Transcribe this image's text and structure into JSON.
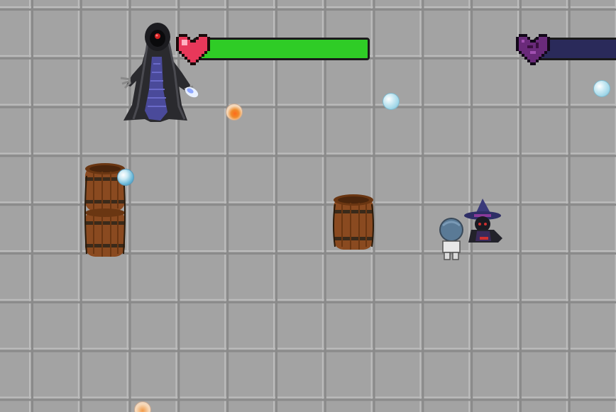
{
  "game": {
    "player_health": {
      "fraction": 1.0,
      "fill_color": "#2fcc26",
      "heart_color": "#e8385a",
      "icon": "heart-icon"
    },
    "enemy_health": {
      "fraction": 1.0,
      "fill_color": "#2a2a5a",
      "heart_color": "#6a2a7a",
      "icon": "dark-heart-icon"
    },
    "entities": {
      "boss": "hooded-reaper-boss",
      "player": "blue-haired-player",
      "companion": "purple-hat-witch",
      "obstacles": [
        "barrel",
        "barrel",
        "barrel"
      ]
    },
    "projectiles": {
      "water_orb_color": "#9fd6e8",
      "fire_orb_color": "#f08a2a"
    },
    "colors": {
      "floor": "#a3a3a3",
      "grid_dark": "#8a8a8a",
      "grid_light": "#bdbdbd",
      "barrel_wood": "#8a4a20",
      "barrel_band": "#3a2a1a"
    }
  }
}
